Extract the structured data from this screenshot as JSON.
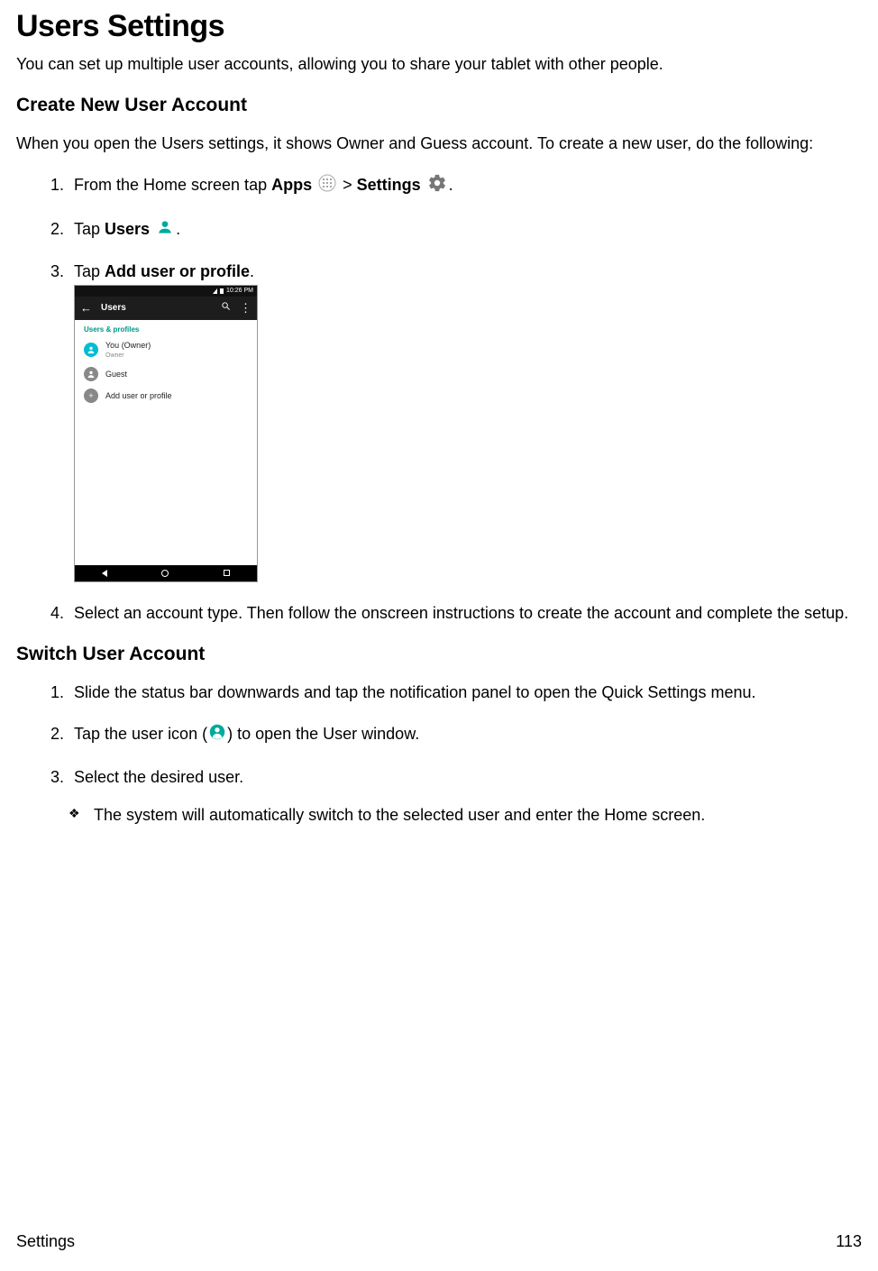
{
  "title": "Users Settings",
  "intro": "You can set up multiple user accounts, allowing you to share your tablet with other people.",
  "create": {
    "heading": "Create New User Account",
    "intro": "When you open the Users settings, it shows Owner and Guess account. To create a new user, do the following:",
    "step1": {
      "prefix": "From the Home screen tap ",
      "apps": "Apps",
      "sep": " > ",
      "settings": "Settings",
      "suffix": "."
    },
    "step2": {
      "prefix": "Tap ",
      "users": "Users",
      "suffix": "."
    },
    "step3": {
      "prefix": "Tap ",
      "bold": "Add user or profile",
      "suffix": "."
    },
    "step4": "Select an account type. Then follow the onscreen instructions to create the account and complete the setup."
  },
  "switch": {
    "heading": "Switch User Account",
    "step1": "Slide the status bar downwards and tap the notification panel to open the Quick Settings menu.",
    "step2": {
      "prefix": "Tap the user icon (",
      "suffix": ") to open the User window."
    },
    "step3": "Select the desired user.",
    "note": "The system will automatically switch to the selected user and enter the Home screen."
  },
  "screenshot": {
    "time": "10:26 PM",
    "appbar_title": "Users",
    "section_label": "Users & profiles",
    "owner_line1": "You (Owner)",
    "owner_line2": "Owner",
    "guest": "Guest",
    "add": "Add user or profile"
  },
  "footer": {
    "left": "Settings",
    "right": "113"
  },
  "colors": {
    "teal": "#009688"
  }
}
